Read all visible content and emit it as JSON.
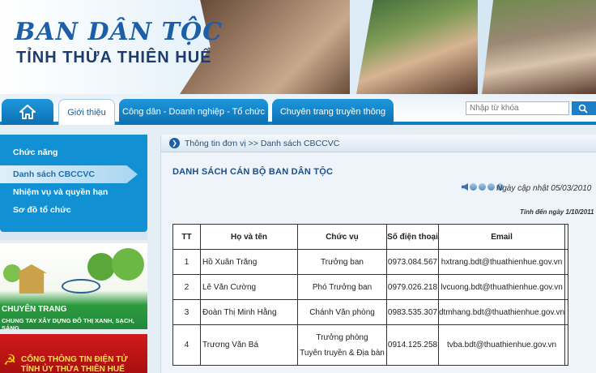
{
  "header": {
    "logo_main": "BAN DÂN TỘC",
    "logo_sub": "TỈNH THỪA THIÊN HUẾ"
  },
  "nav": {
    "home_icon": "home-icon",
    "tabs": [
      {
        "label": "Giới thiệu",
        "active": true
      },
      {
        "label": "Công dân - Doanh nghiệp - Tổ chức",
        "active": false
      },
      {
        "label": "Chuyên trang truyền thông",
        "active": false
      }
    ],
    "search_placeholder": "Nhập từ khóa",
    "search_icon": "search-icon"
  },
  "sidebar": {
    "items": [
      {
        "label": "Chức năng",
        "active": false
      },
      {
        "label": "Danh sách CBCCVC",
        "active": true
      },
      {
        "label": "Nhiệm vụ và quyền hạn",
        "active": false
      },
      {
        "label": "Sơ đồ tổ chức",
        "active": false
      }
    ],
    "banner1": {
      "title": "CHUYÊN TRANG",
      "subtitle": "CHUNG TAY XÂY DỰNG ĐÔ THỊ XANH, SẠCH, SÁNG"
    },
    "banner2": {
      "text": "CỔNG THÔNG TIN ĐIỆN TỬ TỈNH ỦY THỪA THIÊN HUẾ"
    }
  },
  "main": {
    "breadcrumb": "Thông tin đơn vị >> Danh sách CBCCVC",
    "title": "DANH SÁCH CÁN BỘ BAN DÂN TỘC",
    "updated": "Ngày cập nhật 05/03/2010",
    "as_of": "Tính đến ngày 1/10/2011",
    "table": {
      "headers": [
        "TT",
        "Họ và tên",
        "Chức vụ",
        "Số điện thoại",
        "Email"
      ],
      "rows": [
        {
          "tt": "1",
          "name": "Hồ Xuân Trăng",
          "position": "Trưởng ban",
          "position2": "",
          "phone": "0973.084.567",
          "email": "hxtrang.bdt@thuathienhue.gov.vn"
        },
        {
          "tt": "2",
          "name": "Lê Văn Cường",
          "position": "Phó Trưởng ban",
          "position2": "",
          "phone": "0979.026.218",
          "email": "lvcuong.bdt@thuathienhue.gov.vn"
        },
        {
          "tt": "3",
          "name": "Đoàn Thị Minh Hằng",
          "position": "Chánh Văn phòng",
          "position2": "",
          "phone": "0983.535.307",
          "email": "dtmhang.bdt@thuathienhue.gov.vn"
        },
        {
          "tt": "4",
          "name": "Trương Văn Bá",
          "position": "Trưởng phòng",
          "position2": "Tuyên truyền & Địa bàn",
          "phone": "0914.125.258",
          "email": "tvba.bdt@thuathienhue.gov.vn"
        }
      ]
    }
  }
}
